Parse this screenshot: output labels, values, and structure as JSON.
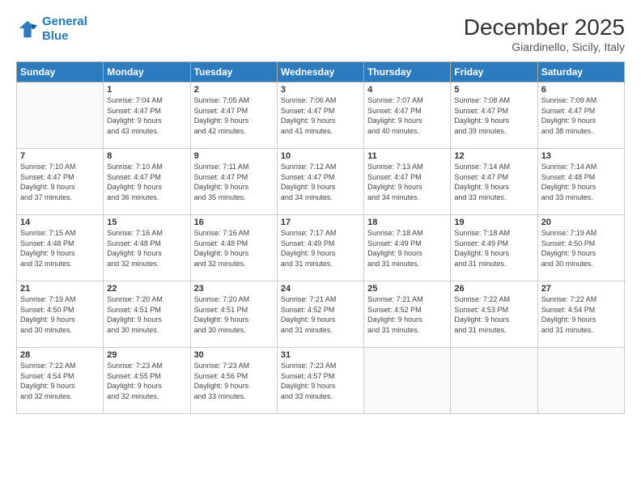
{
  "header": {
    "logo_line1": "General",
    "logo_line2": "Blue",
    "title": "December 2025",
    "subtitle": "Giardinello, Sicily, Italy"
  },
  "weekdays": [
    "Sunday",
    "Monday",
    "Tuesday",
    "Wednesday",
    "Thursday",
    "Friday",
    "Saturday"
  ],
  "weeks": [
    [
      {
        "day": "",
        "info": ""
      },
      {
        "day": "1",
        "info": "Sunrise: 7:04 AM\nSunset: 4:47 PM\nDaylight: 9 hours\nand 43 minutes."
      },
      {
        "day": "2",
        "info": "Sunrise: 7:05 AM\nSunset: 4:47 PM\nDaylight: 9 hours\nand 42 minutes."
      },
      {
        "day": "3",
        "info": "Sunrise: 7:06 AM\nSunset: 4:47 PM\nDaylight: 9 hours\nand 41 minutes."
      },
      {
        "day": "4",
        "info": "Sunrise: 7:07 AM\nSunset: 4:47 PM\nDaylight: 9 hours\nand 40 minutes."
      },
      {
        "day": "5",
        "info": "Sunrise: 7:08 AM\nSunset: 4:47 PM\nDaylight: 9 hours\nand 39 minutes."
      },
      {
        "day": "6",
        "info": "Sunrise: 7:09 AM\nSunset: 4:47 PM\nDaylight: 9 hours\nand 38 minutes."
      }
    ],
    [
      {
        "day": "7",
        "info": "Sunrise: 7:10 AM\nSunset: 4:47 PM\nDaylight: 9 hours\nand 37 minutes."
      },
      {
        "day": "8",
        "info": "Sunrise: 7:10 AM\nSunset: 4:47 PM\nDaylight: 9 hours\nand 36 minutes."
      },
      {
        "day": "9",
        "info": "Sunrise: 7:11 AM\nSunset: 4:47 PM\nDaylight: 9 hours\nand 35 minutes."
      },
      {
        "day": "10",
        "info": "Sunrise: 7:12 AM\nSunset: 4:47 PM\nDaylight: 9 hours\nand 34 minutes."
      },
      {
        "day": "11",
        "info": "Sunrise: 7:13 AM\nSunset: 4:47 PM\nDaylight: 9 hours\nand 34 minutes."
      },
      {
        "day": "12",
        "info": "Sunrise: 7:14 AM\nSunset: 4:47 PM\nDaylight: 9 hours\nand 33 minutes."
      },
      {
        "day": "13",
        "info": "Sunrise: 7:14 AM\nSunset: 4:48 PM\nDaylight: 9 hours\nand 33 minutes."
      }
    ],
    [
      {
        "day": "14",
        "info": "Sunrise: 7:15 AM\nSunset: 4:48 PM\nDaylight: 9 hours\nand 32 minutes."
      },
      {
        "day": "15",
        "info": "Sunrise: 7:16 AM\nSunset: 4:48 PM\nDaylight: 9 hours\nand 32 minutes."
      },
      {
        "day": "16",
        "info": "Sunrise: 7:16 AM\nSunset: 4:48 PM\nDaylight: 9 hours\nand 32 minutes."
      },
      {
        "day": "17",
        "info": "Sunrise: 7:17 AM\nSunset: 4:49 PM\nDaylight: 9 hours\nand 31 minutes."
      },
      {
        "day": "18",
        "info": "Sunrise: 7:18 AM\nSunset: 4:49 PM\nDaylight: 9 hours\nand 31 minutes."
      },
      {
        "day": "19",
        "info": "Sunrise: 7:18 AM\nSunset: 4:49 PM\nDaylight: 9 hours\nand 31 minutes."
      },
      {
        "day": "20",
        "info": "Sunrise: 7:19 AM\nSunset: 4:50 PM\nDaylight: 9 hours\nand 30 minutes."
      }
    ],
    [
      {
        "day": "21",
        "info": "Sunrise: 7:19 AM\nSunset: 4:50 PM\nDaylight: 9 hours\nand 30 minutes."
      },
      {
        "day": "22",
        "info": "Sunrise: 7:20 AM\nSunset: 4:51 PM\nDaylight: 9 hours\nand 30 minutes."
      },
      {
        "day": "23",
        "info": "Sunrise: 7:20 AM\nSunset: 4:51 PM\nDaylight: 9 hours\nand 30 minutes."
      },
      {
        "day": "24",
        "info": "Sunrise: 7:21 AM\nSunset: 4:52 PM\nDaylight: 9 hours\nand 31 minutes."
      },
      {
        "day": "25",
        "info": "Sunrise: 7:21 AM\nSunset: 4:52 PM\nDaylight: 9 hours\nand 31 minutes."
      },
      {
        "day": "26",
        "info": "Sunrise: 7:22 AM\nSunset: 4:53 PM\nDaylight: 9 hours\nand 31 minutes."
      },
      {
        "day": "27",
        "info": "Sunrise: 7:22 AM\nSunset: 4:54 PM\nDaylight: 9 hours\nand 31 minutes."
      }
    ],
    [
      {
        "day": "28",
        "info": "Sunrise: 7:22 AM\nSunset: 4:54 PM\nDaylight: 9 hours\nand 32 minutes."
      },
      {
        "day": "29",
        "info": "Sunrise: 7:23 AM\nSunset: 4:55 PM\nDaylight: 9 hours\nand 32 minutes."
      },
      {
        "day": "30",
        "info": "Sunrise: 7:23 AM\nSunset: 4:56 PM\nDaylight: 9 hours\nand 33 minutes."
      },
      {
        "day": "31",
        "info": "Sunrise: 7:23 AM\nSunset: 4:57 PM\nDaylight: 9 hours\nand 33 minutes."
      },
      {
        "day": "",
        "info": ""
      },
      {
        "day": "",
        "info": ""
      },
      {
        "day": "",
        "info": ""
      }
    ]
  ]
}
